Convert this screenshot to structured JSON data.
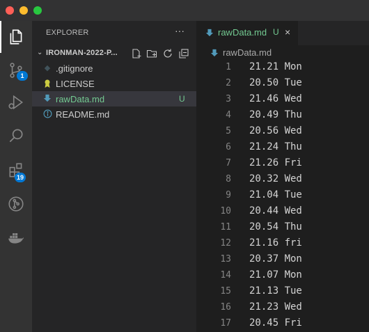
{
  "window": {
    "traffic_lights": [
      "close",
      "minimize",
      "zoom"
    ]
  },
  "activity_bar": {
    "items": [
      {
        "icon": "files-icon",
        "active": true
      },
      {
        "icon": "source-control-icon",
        "badge": "1"
      },
      {
        "icon": "run-debug-icon"
      },
      {
        "icon": "search-icon"
      },
      {
        "icon": "extensions-icon",
        "badge": "19"
      },
      {
        "icon": "git-graph-icon"
      },
      {
        "icon": "docker-icon"
      }
    ]
  },
  "sidebar": {
    "title": "EXPLORER",
    "more": "···",
    "folder": {
      "name": "IRONMAN-2022-P...",
      "tools": [
        "new-file-icon",
        "new-folder-icon",
        "refresh-icon",
        "collapse-all-icon"
      ]
    },
    "files": [
      {
        "name": ".gitignore",
        "icon": "gitignore-icon",
        "status": ""
      },
      {
        "name": "LICENSE",
        "icon": "license-icon",
        "status": ""
      },
      {
        "name": "rawData.md",
        "icon": "markdown-icon",
        "status": "U",
        "selected": true
      },
      {
        "name": "README.md",
        "icon": "info-icon",
        "status": ""
      }
    ]
  },
  "editor": {
    "tab": {
      "label": "rawData.md",
      "status": "U",
      "close": "×"
    },
    "breadcrumb": "rawData.md",
    "lines": [
      {
        "n": "1",
        "text": "21.21 Mon"
      },
      {
        "n": "2",
        "text": "20.50 Tue"
      },
      {
        "n": "3",
        "text": "21.46 Wed"
      },
      {
        "n": "4",
        "text": "20.49 Thu"
      },
      {
        "n": "5",
        "text": "20.56 Wed"
      },
      {
        "n": "6",
        "text": "21.24 Thu"
      },
      {
        "n": "7",
        "text": "21.26 Fri"
      },
      {
        "n": "8",
        "text": "20.32 Wed"
      },
      {
        "n": "9",
        "text": "21.04 Tue"
      },
      {
        "n": "10",
        "text": "20.44 Wed"
      },
      {
        "n": "11",
        "text": "20.54 Thu"
      },
      {
        "n": "12",
        "text": "21.16 fri"
      },
      {
        "n": "13",
        "text": "20.37 Mon"
      },
      {
        "n": "14",
        "text": "21.07 Mon"
      },
      {
        "n": "15",
        "text": "21.13 Tue"
      },
      {
        "n": "16",
        "text": "21.23 Wed"
      },
      {
        "n": "17",
        "text": "20.45 Fri"
      }
    ]
  },
  "colors": {
    "untracked": "#73c991",
    "badge": "#0078d4",
    "markdown_icon": "#519aba"
  }
}
